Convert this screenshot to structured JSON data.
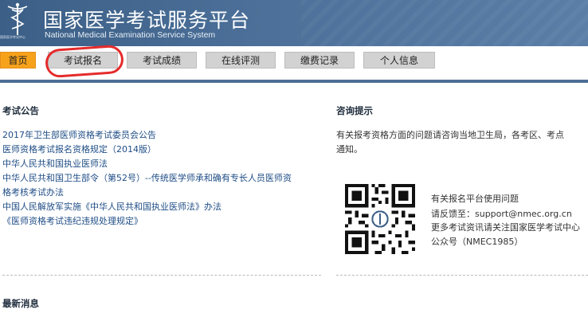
{
  "header": {
    "title": "国家医学考试服务平台",
    "subtitle": "National Medical Examination Service System",
    "logo_text": "国家医学考试中心"
  },
  "nav": {
    "tabs": [
      {
        "label": "首页",
        "active": true
      },
      {
        "label": "考试报名",
        "active": false
      },
      {
        "label": "考试成绩",
        "active": false
      },
      {
        "label": "在线评测",
        "active": false
      },
      {
        "label": "缴费记录",
        "active": false
      },
      {
        "label": "个人信息",
        "active": false
      }
    ]
  },
  "announcements": {
    "title": "考试公告",
    "items": [
      "2017年卫生部医师资格考试委员会公告",
      "医师资格考试报名资格规定（2014版）",
      "中华人民共和国执业医师法",
      "中华人民共和国卫生部令（第52号）--传统医学师承和确有专长人员医师资",
      "格考核考试办法",
      "中国人民解放军实施《中华人民共和国执业医师法》办法",
      "《医师资格考试违纪违规处理规定》"
    ]
  },
  "consult": {
    "title": "咨询提示",
    "line1": "有关报考资格方面的问题请咨询当地卫生局，各考区、考点",
    "line2": "通知。",
    "contact_lines": [
      "有关报名平台使用问题",
      "请反馈至：support@nmec.org.cn",
      "更多考试资讯请关注国家医学考试中心",
      "公众号（NMEC1985）"
    ]
  },
  "news": {
    "title": "最新消息"
  },
  "colors": {
    "header_bg": "#4c7099",
    "nav_active": "#f7a21b",
    "nav_tab": "#d2d2d2",
    "link": "#1f4d86",
    "annotation": "#e52b2b"
  }
}
